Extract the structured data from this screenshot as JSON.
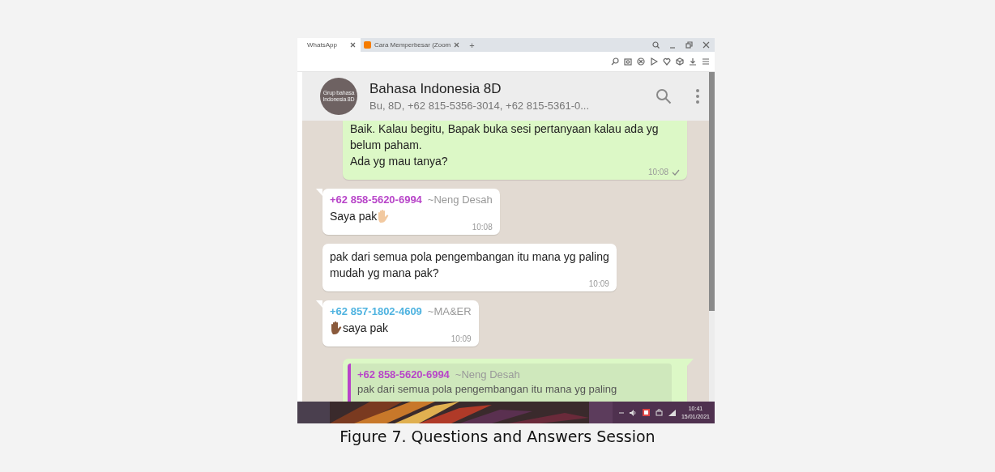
{
  "browser": {
    "tabs": [
      {
        "label": "WhatsApp",
        "selected": true
      },
      {
        "label": "Cara Memperbesar (Zoom",
        "selected": false
      }
    ],
    "new_tab": "+"
  },
  "chat": {
    "avatar_text": "Grup bahasa Indonesia 8D",
    "title": "Bahasa Indonesia 8D",
    "subtitle": "Bu, 8D, +62 815-5356-3014, +62 815-5361-0..."
  },
  "messages": [
    {
      "kind": "outgoing",
      "text": "Baik. Kalau begitu, Bapak buka sesi pertanyaan kalau ada yg\nbelum paham.\nAda yg mau tanya?",
      "time": "10:08",
      "sent": true
    },
    {
      "kind": "incoming",
      "sender": "+62 858-5620-6994",
      "name": "~Neng Desah",
      "color": "#b845c9",
      "parts": [
        {
          "kind": "text",
          "text": "Saya pak"
        },
        {
          "kind": "hand",
          "color": "#f2c9a0"
        }
      ],
      "time": "10:08",
      "tail": true
    },
    {
      "kind": "incoming",
      "text": "pak dari semua pola pengembangan itu mana yg paling\nmudah yg mana pak?",
      "time": "10:09",
      "tail": false
    },
    {
      "kind": "incoming",
      "sender": "+62 857-1802-4609",
      "name": "~MA&ER",
      "color": "#4fb3e0",
      "parts": [
        {
          "kind": "hand",
          "color": "#8a5a3c"
        },
        {
          "kind": "text",
          "text": "saya pak"
        }
      ],
      "time": "10:09",
      "tail": true
    },
    {
      "kind": "outgoing",
      "tail": true,
      "quote": {
        "sender": "+62 858-5620-6994",
        "name": "~Neng Desah",
        "color": "#b845c9",
        "text": "pak dari semua pola pengembangan itu mana yg paling"
      }
    }
  ],
  "taskbar": {
    "time": "10:41",
    "date": "15/01/2021"
  },
  "caption": "Figure 7. Questions and Answers Session"
}
